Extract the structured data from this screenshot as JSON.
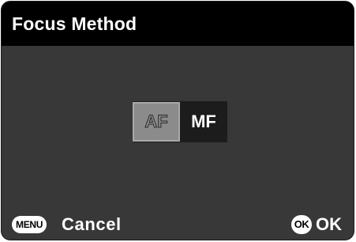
{
  "header": {
    "title": "Focus Method"
  },
  "options": [
    {
      "label": "AF",
      "selected": true
    },
    {
      "label": "MF",
      "selected": false
    }
  ],
  "footer": {
    "menu_button": "MENU",
    "cancel_label": "Cancel",
    "ok_button": "OK",
    "ok_label": "OK"
  },
  "colors": {
    "screen_background": "#383838",
    "header_background": "#000000",
    "selected_option_background": "#8b8b8b",
    "unselected_option_background": "#1c1c1c",
    "text": "#ffffff"
  }
}
